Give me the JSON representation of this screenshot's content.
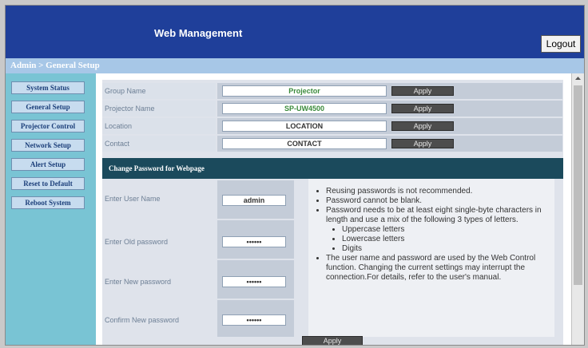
{
  "header": {
    "title": "Web Management",
    "logout_label": "Logout"
  },
  "breadcrumb": "Admin > General Setup",
  "sidebar": {
    "items": [
      {
        "label": "System Status"
      },
      {
        "label": "General Setup"
      },
      {
        "label": "Projector Control"
      },
      {
        "label": "Network Setup"
      },
      {
        "label": "Alert Setup"
      },
      {
        "label": "Reset to Default"
      },
      {
        "label": "Reboot System"
      }
    ]
  },
  "settings": {
    "rows": [
      {
        "label": "Group Name",
        "value": "Projector",
        "button": "Apply"
      },
      {
        "label": "Projector Name",
        "value": "SP-UW4500",
        "button": "Apply"
      },
      {
        "label": "Location",
        "value": "LOCATION",
        "button": "Apply"
      },
      {
        "label": "Contact",
        "value": "CONTACT",
        "button": "Apply"
      }
    ]
  },
  "password_section": {
    "title": "Change Password for Webpage",
    "fields": [
      {
        "label": "Enter User Name",
        "value": "admin"
      },
      {
        "label": "Enter Old password",
        "value": "••••••"
      },
      {
        "label": "Enter New password",
        "value": "••••••"
      },
      {
        "label": "Confirm New password",
        "value": "••••••"
      }
    ],
    "notes": [
      "Reusing passwords is not recommended.",
      "Password cannot be blank.",
      "Password needs to be at least eight single-byte characters in length and use a mix of the following 3 types of letters."
    ],
    "letter_types": [
      "Uppercase letters",
      "Lowercase letters",
      "Digits"
    ],
    "final_note": "The user name and password are used by the Web Control function. Changing the current settings may interrupt the connection.For details, refer to the user's manual.",
    "apply_label": "Apply"
  },
  "colors": {
    "header": "#1f3f9a",
    "sidebar": "#79c4d4",
    "section_header": "#1b4a5c",
    "value_text": "#3a8a3a"
  }
}
